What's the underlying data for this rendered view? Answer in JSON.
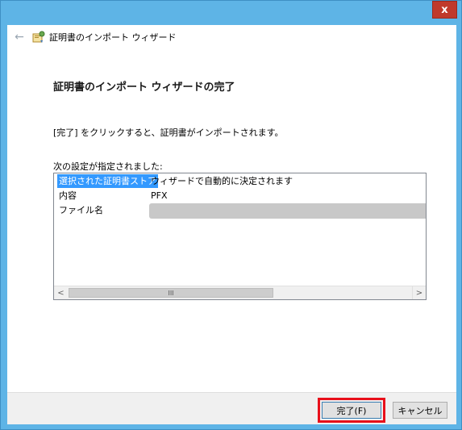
{
  "window": {
    "close_label": "x"
  },
  "header": {
    "title": "証明書のインポート ウィザード"
  },
  "main": {
    "heading": "証明書のインポート ウィザードの完了",
    "intro": "[完了] をクリックすると、証明書がインポートされます。",
    "settings_label": "次の設定が指定されました:"
  },
  "settings": {
    "rows": [
      {
        "key": "選択された証明書ストア",
        "value": "ウィザードで自動的に決定されます"
      },
      {
        "key": "内容",
        "value": "PFX"
      },
      {
        "key": "ファイル名",
        "value": ""
      }
    ]
  },
  "scrollbar": {
    "left_glyph": "<",
    "right_glyph": ">",
    "thumb_glyph": "III"
  },
  "footer": {
    "finish_label": "完了(F)",
    "cancel_label": "キャンセル"
  },
  "colors": {
    "title_bar": "#5eb4e6",
    "close_button": "#c0392b",
    "selection": "#3399ff",
    "highlight_box": "#e8101b"
  }
}
